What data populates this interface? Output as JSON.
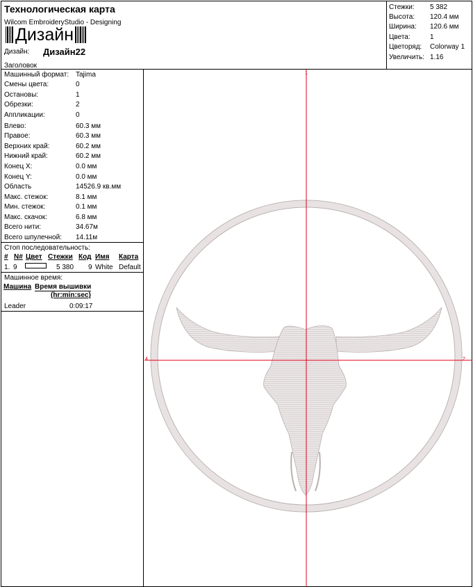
{
  "header": {
    "title": "Технологическая карта",
    "subtitle": "Wilcom EmbroideryStudio - Designing",
    "barcode_text": "Дизайн",
    "design_label": "Дизайн:",
    "design_value": "Дизайн22",
    "heading_label": "Заголовок"
  },
  "stats": [
    {
      "label": "Стежки:",
      "value": "5 382"
    },
    {
      "label": "Высота:",
      "value": "120.4 мм"
    },
    {
      "label": "Ширина:",
      "value": "120.6 мм"
    },
    {
      "label": "Цвета:",
      "value": "1"
    },
    {
      "label": "Цветоряд:",
      "value": "Colorway 1"
    },
    {
      "label": "Увеличить:",
      "value": "1.16"
    }
  ],
  "info": [
    {
      "label": "Машинный формат:",
      "value": "Tajima"
    },
    {
      "label": "Смены цвета:",
      "value": "0"
    },
    {
      "label": "Остановы:",
      "value": "1"
    },
    {
      "label": "Обрезки:",
      "value": "2"
    },
    {
      "label": "Аппликации:",
      "value": "0"
    },
    {
      "label": "Влево:",
      "value": "60.3 мм"
    },
    {
      "label": "Правое:",
      "value": "60.3 мм"
    },
    {
      "label": "Верхних край:",
      "value": "60.2 мм"
    },
    {
      "label": "Нижний край:",
      "value": "60.2 мм"
    },
    {
      "label": "Конец X:",
      "value": "0.0 мм"
    },
    {
      "label": "Конец Y:",
      "value": "0.0 мм"
    },
    {
      "label": "Область",
      "value": "14526.9 кв.мм"
    },
    {
      "label": "Макс. стежок:",
      "value": "8.1 мм"
    },
    {
      "label": "Мин. стежок:",
      "value": "0.1 мм"
    },
    {
      "label": "Макс. скачок:",
      "value": "6.8 мм"
    },
    {
      "label": "Всего нити:",
      "value": "34.67м"
    },
    {
      "label": "Всего шпулечной:",
      "value": "14.11м"
    }
  ],
  "stop_sequence": {
    "title": "Стоп последовательность:",
    "headers": [
      "#",
      "N#",
      "Цвет",
      "Стежки",
      "Код",
      "Имя",
      "Карта"
    ],
    "row": {
      "num": "1.",
      "n": "9",
      "stitches": "5 380",
      "code": "9",
      "name": "White",
      "chart": "Default"
    }
  },
  "machine_time": {
    "title": "Машинное время:",
    "col1": "Машина",
    "col2": "Время вышивки",
    "col2_sub": "(hr:min:sec)",
    "machine": "Leader",
    "time": "0:09:17"
  },
  "canvas": {
    "marker_top": "1",
    "marker_left": "4",
    "marker_right": "2",
    "axis_color": "#e0001a",
    "thread_color": "#e8e2e2",
    "thread_edge": "#b9b0b0"
  }
}
